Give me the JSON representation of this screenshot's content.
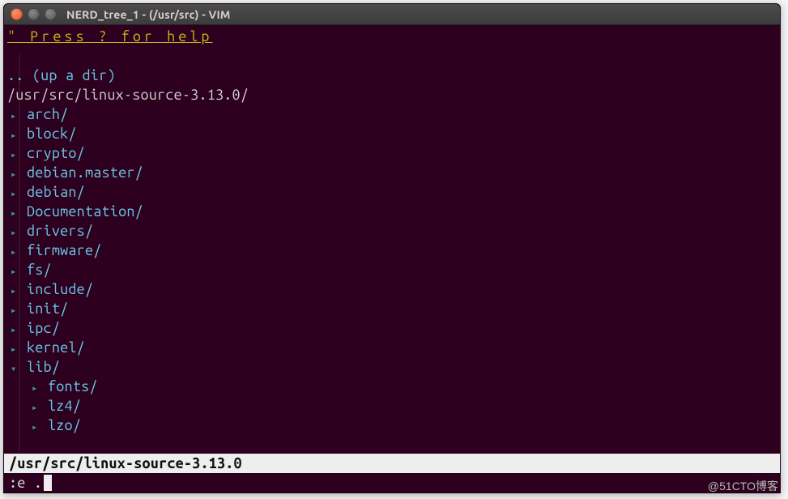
{
  "window": {
    "title": "NERD_tree_1 - (/usr/src) - VIM"
  },
  "help_line": "\" Press ? for help",
  "updir_text": ".. (up a dir)",
  "root_path": "/usr/src/linux-source-3.13.0/",
  "tree": [
    {
      "depth": 1,
      "expanded": false,
      "name": "arch/"
    },
    {
      "depth": 1,
      "expanded": false,
      "name": "block/"
    },
    {
      "depth": 1,
      "expanded": false,
      "name": "crypto/"
    },
    {
      "depth": 1,
      "expanded": false,
      "name": "debian.master/"
    },
    {
      "depth": 1,
      "expanded": false,
      "name": "debian/"
    },
    {
      "depth": 1,
      "expanded": false,
      "name": "Documentation/"
    },
    {
      "depth": 1,
      "expanded": false,
      "name": "drivers/"
    },
    {
      "depth": 1,
      "expanded": false,
      "name": "firmware/"
    },
    {
      "depth": 1,
      "expanded": false,
      "name": "fs/"
    },
    {
      "depth": 1,
      "expanded": false,
      "name": "include/"
    },
    {
      "depth": 1,
      "expanded": false,
      "name": "init/"
    },
    {
      "depth": 1,
      "expanded": false,
      "name": "ipc/"
    },
    {
      "depth": 1,
      "expanded": false,
      "name": "kernel/"
    },
    {
      "depth": 1,
      "expanded": true,
      "name": "lib/"
    },
    {
      "depth": 2,
      "expanded": false,
      "name": "fonts/"
    },
    {
      "depth": 2,
      "expanded": false,
      "name": "lz4/"
    },
    {
      "depth": 2,
      "expanded": false,
      "name": "lzo/"
    }
  ],
  "status_bar": "/usr/src/linux-source-3.13.0",
  "command_line": ":e .",
  "watermark": "@51CTO博客"
}
